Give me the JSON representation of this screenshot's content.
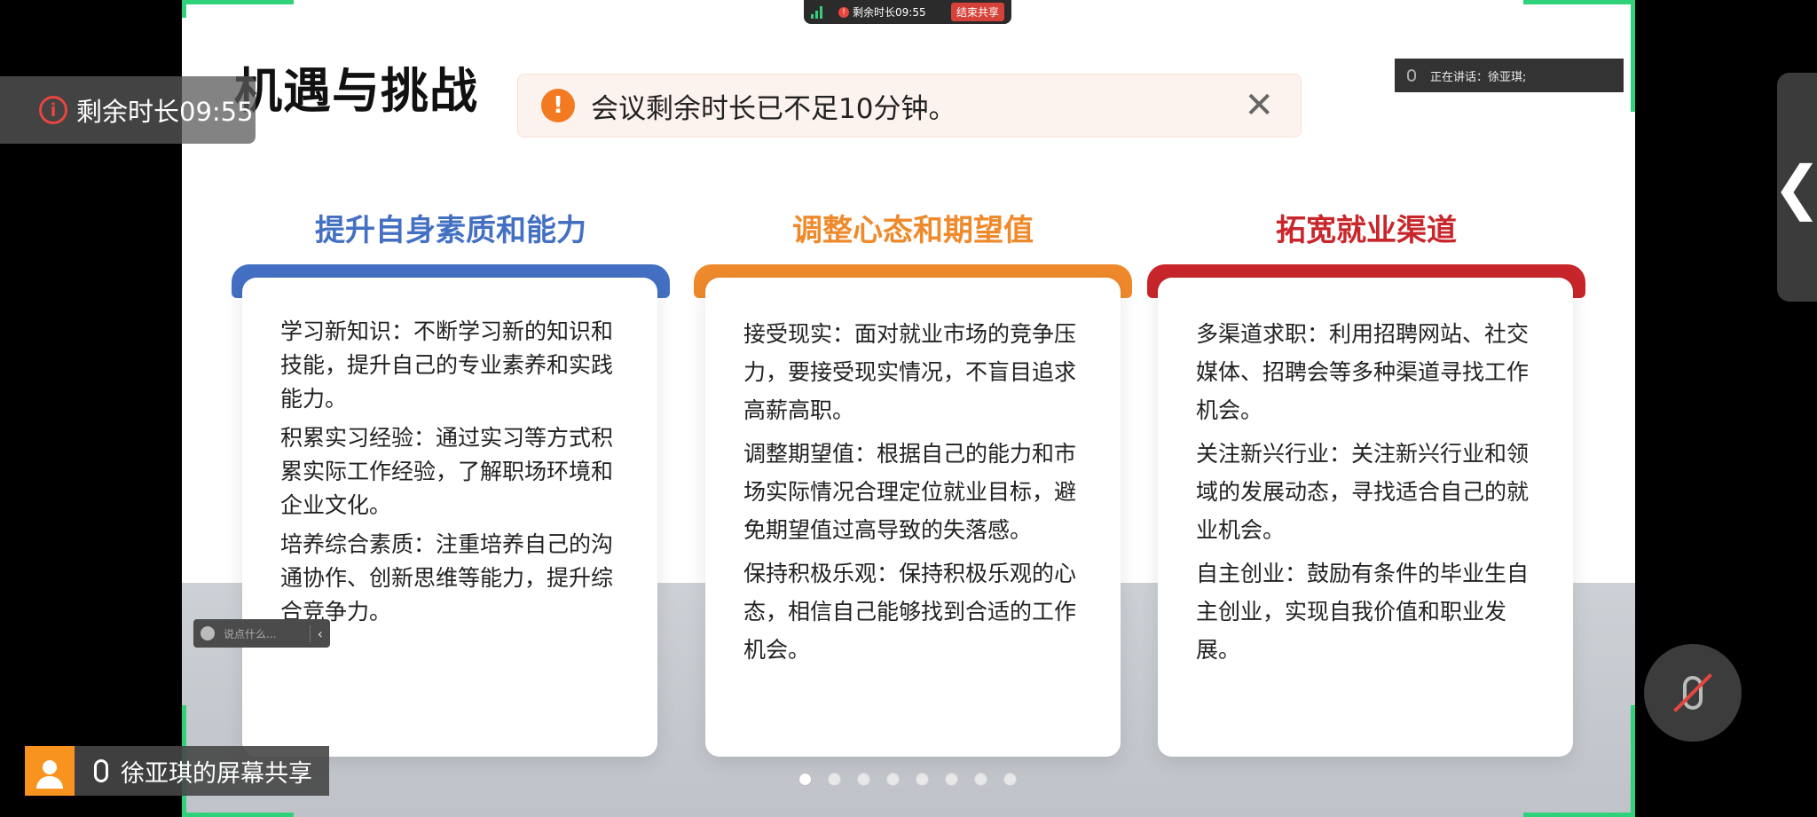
{
  "top_status": {
    "remaining": "剩余时长09:55",
    "stop_label": "结束共享"
  },
  "remaining_chip": {
    "text": "剩余时长09:55"
  },
  "toast": {
    "message": "会议剩余时长已不足10分钟。",
    "close": "✕"
  },
  "speaking": {
    "text": "正在讲话：徐亚琪;"
  },
  "slide": {
    "title": "机遇与挑战",
    "columns": [
      {
        "heading": "提升自身素质和能力",
        "color": "#4470c4",
        "items": [
          "学习新知识：不断学习新的知识和技能，提升自己的专业素养和实践能力。",
          "积累实习经验：通过实习等方式积累实际工作经验，了解职场环境和企业文化。",
          "培养综合素质：注重培养自己的沟通协作、创新思维等能力，提升综合竞争力。"
        ]
      },
      {
        "heading": "调整心态和期望值",
        "color": "#ef8a2c",
        "items": [
          "接受现实：面对就业市场的竞争压力，要接受现实情况，不盲目追求高薪高职。",
          "调整期望值：根据自己的能力和市场实际情况合理定位就业目标，避免期望值过高导致的失落感。",
          "保持积极乐观：保持积极乐观的心态，相信自己能够找到合适的工作机会。"
        ]
      },
      {
        "heading": "拓宽就业渠道",
        "color": "#c8262b",
        "items": [
          "多渠道求职：利用招聘网站、社交媒体、招聘会等多种渠道寻找工作机会。",
          "关注新兴行业：关注新兴行业和领域的发展动态，寻找适合自己的就业机会。",
          "自主创业：鼓励有条件的毕业生自主创业，实现自我价值和职业发展。"
        ]
      }
    ]
  },
  "chat": {
    "placeholder": "说点什么..."
  },
  "share": {
    "label": "徐亚琪的屏幕共享"
  },
  "pager": {
    "active_index": 0
  }
}
